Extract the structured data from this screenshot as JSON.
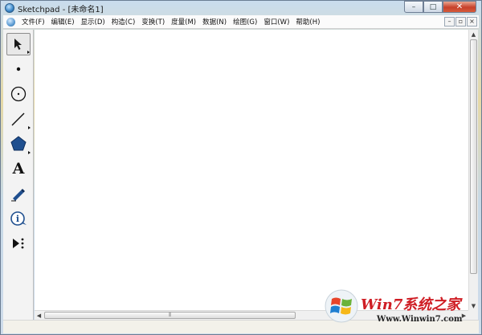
{
  "window": {
    "title": "Sketchpad - [未命名1]"
  },
  "caption_buttons": {
    "minimize": "–",
    "maximize": "□",
    "close": "✕"
  },
  "menu": {
    "items": [
      "文件(F)",
      "编辑(E)",
      "显示(D)",
      "构造(C)",
      "变换(T)",
      "度量(M)",
      "数据(N)",
      "绘图(G)",
      "窗口(W)",
      "帮助(H)"
    ],
    "doc_buttons": {
      "minimize": "–",
      "restore": "▫",
      "close": "×"
    }
  },
  "toolbox": {
    "tools": [
      {
        "name": "selection-arrow-tool",
        "icon": "arrow-cursor-icon",
        "selected": true
      },
      {
        "name": "point-tool",
        "icon": "point-icon",
        "selected": false
      },
      {
        "name": "compass-tool",
        "icon": "circle-icon",
        "selected": false
      },
      {
        "name": "straightedge-tool",
        "icon": "line-segment-icon",
        "selected": false
      },
      {
        "name": "polygon-tool",
        "icon": "pentagon-icon",
        "selected": false
      },
      {
        "name": "text-tool",
        "icon": "letter-a-icon",
        "label": "A",
        "selected": false
      },
      {
        "name": "marker-tool",
        "icon": "pen-icon",
        "selected": false
      },
      {
        "name": "information-tool",
        "icon": "info-bubble-icon",
        "label": "i",
        "selected": false
      },
      {
        "name": "custom-tools",
        "icon": "play-dots-icon",
        "selected": false
      }
    ]
  },
  "scrollbars": {
    "horizontal_grip": "⦀"
  },
  "watermark": {
    "title": "Win7系统之家",
    "url": "Www.Winwin7.com"
  },
  "colors": {
    "close_button": "#c7402a",
    "canvas": "#ffffff",
    "watermark_red": "#cf1d24",
    "toolbar_blue": "#1f4f8f"
  }
}
